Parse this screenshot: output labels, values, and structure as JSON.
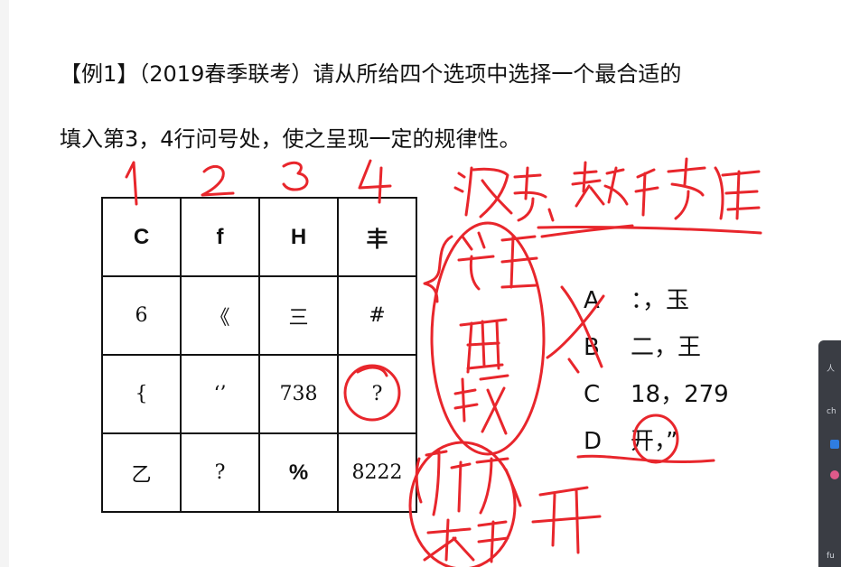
{
  "question": {
    "line1": "【例1】（2019春季联考）请从所给四个选项中选择一个最合适的",
    "line2": "填入第3，4行问号处，使之呈现一定的规律性。"
  },
  "grid": {
    "rows": [
      [
        "C",
        "f",
        "H",
        "丰"
      ],
      [
        "6",
        "《",
        "三",
        "#"
      ],
      [
        "{",
        "‘’",
        "738",
        "?"
      ],
      [
        "乙",
        "?",
        "%",
        "8222"
      ]
    ]
  },
  "options": [
    {
      "letter": "A",
      "text": "：，玉"
    },
    {
      "letter": "B",
      "text": "二，王"
    },
    {
      "letter": "C",
      "text": "18，279"
    },
    {
      "letter": "D",
      "text": "开，”"
    }
  ],
  "side_panel": {
    "items": [
      "人",
      "ch",
      "fu"
    ]
  },
  "colors": {
    "ink": "#e8262c",
    "panel": "#3a3d44",
    "accent_blue": "#2f7de1",
    "accent_pink": "#e05a8a"
  }
}
